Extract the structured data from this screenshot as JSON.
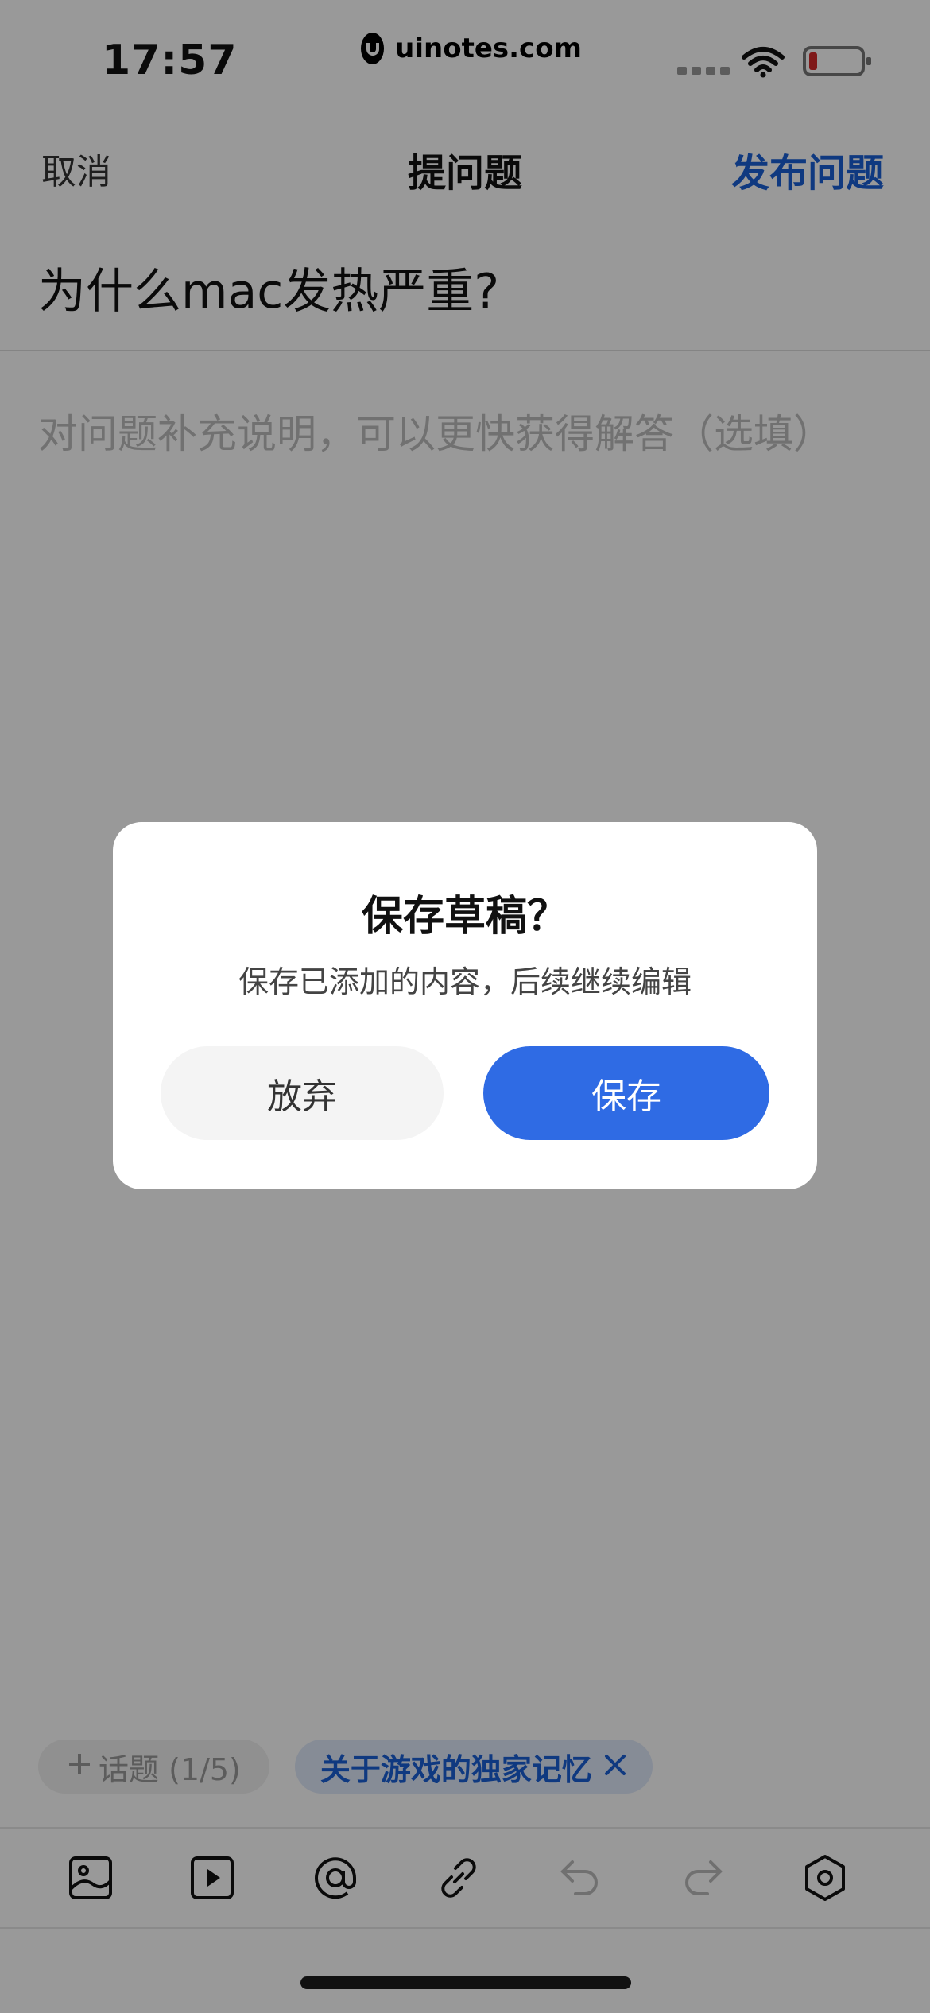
{
  "status_bar": {
    "time": "17:57",
    "brand": "uinotes.com"
  },
  "nav": {
    "cancel": "取消",
    "title": "提问题",
    "publish": "发布问题"
  },
  "editor": {
    "question_title": "为什么mac发热严重?",
    "description_placeholder": "对问题补充说明，可以更快获得解答（选填）"
  },
  "tags": {
    "add_label": "话题 (1/5)",
    "topic_label": "关于游戏的独家记忆"
  },
  "toolbar": {
    "icons": [
      "image-icon",
      "video-icon",
      "mention-icon",
      "link-icon",
      "undo-icon",
      "redo-icon",
      "settings-icon"
    ]
  },
  "dialog": {
    "title": "保存草稿？",
    "message": "保存已添加的内容，后续继续编辑",
    "discard": "放弃",
    "save": "保存"
  },
  "colors": {
    "accent": "#2f6be4",
    "link": "#1a5fd6",
    "overlay": "rgba(0,0,0,0.4)"
  }
}
